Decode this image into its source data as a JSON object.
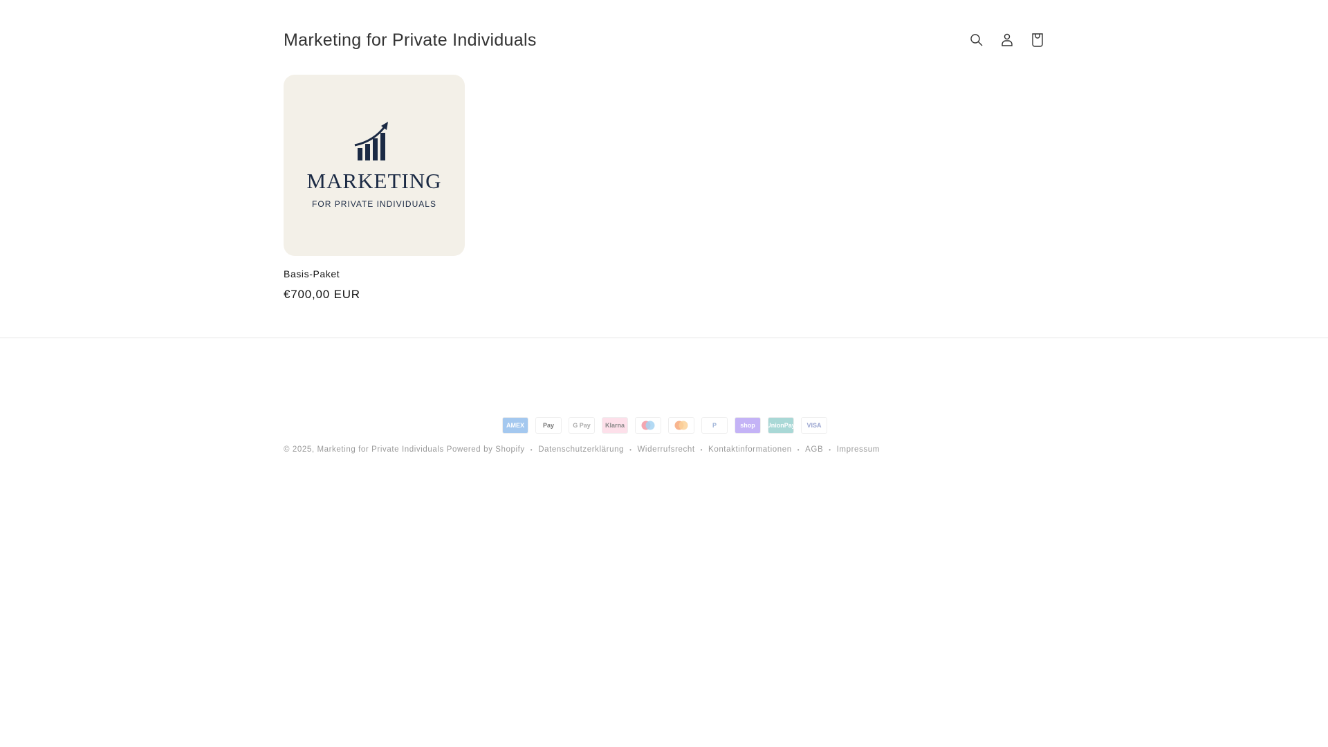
{
  "header": {
    "title": "Marketing for Private Individuals",
    "icons": [
      "search-icon",
      "account-icon",
      "cart-icon"
    ]
  },
  "product": {
    "image_logo": {
      "word": "MARKETING",
      "sub": "FOR PRIVATE INDIVIDUALS"
    },
    "title": "Basis-Paket",
    "price": "€700,00 EUR"
  },
  "payments": [
    {
      "label": "AMEX",
      "bg": "#a4c8ef",
      "fg": "#ffffff"
    },
    {
      "label": "Pay",
      "bg": "#ffffff",
      "fg": "#777777"
    },
    {
      "label": "G Pay",
      "bg": "#ffffff",
      "fg": "#aaaaaa"
    },
    {
      "label": "Klarna",
      "bg": "#fde0ea",
      "fg": "#888888"
    },
    {
      "label": "",
      "bg": "#ffffff",
      "fg": "#f4a6b0"
    },
    {
      "label": "",
      "bg": "#ffffff",
      "fg": "#f8b58f"
    },
    {
      "label": "P",
      "bg": "#ffffff",
      "fg": "#9fb4d8"
    },
    {
      "label": "shop",
      "bg": "#c4b3f6",
      "fg": "#ffffff"
    },
    {
      "label": "UnionPay",
      "bg": "#a9d8d6",
      "fg": "#ffffff"
    },
    {
      "label": "VISA",
      "bg": "#ffffff",
      "fg": "#9aa5d0"
    }
  ],
  "footer": {
    "copyright": "© 2025,",
    "shop_link": "Marketing for Private Individuals",
    "powered": "Powered by Shopify",
    "links": [
      "Datenschutzerklärung",
      "Widerrufsrecht",
      "Kontaktinformationen",
      "AGB",
      "Impressum"
    ]
  }
}
